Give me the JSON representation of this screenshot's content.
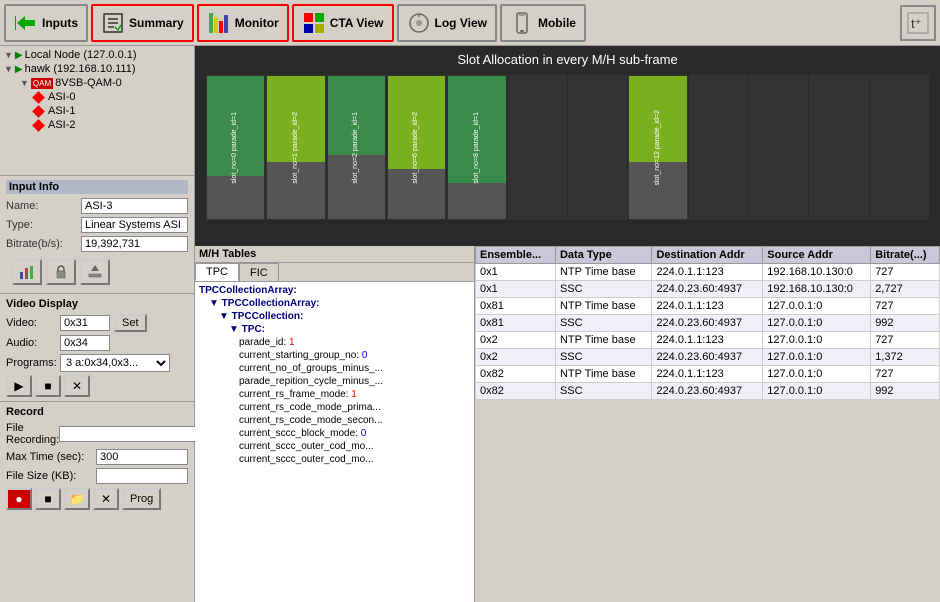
{
  "toolbar": {
    "inputs_label": "Inputs",
    "summary_label": "Summary",
    "monitor_label": "Monitor",
    "cta_view_label": "CTA View",
    "log_view_label": "Log View",
    "mobile_label": "Mobile"
  },
  "tree": {
    "items": [
      {
        "label": "Local Node (127.0.0.1)",
        "level": 0,
        "type": "node"
      },
      {
        "label": "hawk (192.168.10.111)",
        "level": 0,
        "type": "node"
      },
      {
        "label": "8VSB-QAM-0",
        "level": 1,
        "type": "device"
      },
      {
        "label": "ASI-0",
        "level": 2,
        "type": "asi"
      },
      {
        "label": "ASI-1",
        "level": 2,
        "type": "asi"
      },
      {
        "label": "ASI-2",
        "level": 2,
        "type": "asi"
      }
    ]
  },
  "input_info": {
    "title": "Input Info",
    "name_label": "Name:",
    "name_value": "ASI-3",
    "type_label": "Type:",
    "type_value": "Linear Systems ASI",
    "bitrate_label": "Bitrate(b/s):",
    "bitrate_value": "19,392,731"
  },
  "video_display": {
    "title": "Video Display",
    "video_label": "Video:",
    "video_value": "0x31",
    "audio_label": "Audio:",
    "audio_value": "0x34",
    "set_label": "Set",
    "programs_label": "Programs:",
    "programs_value": "3 a:0x34,0x3..."
  },
  "record": {
    "title": "Record",
    "file_recording_label": "File Recording:",
    "max_time_label": "Max Time (sec):",
    "max_time_value": "300",
    "file_size_label": "File Size (KB):",
    "prog_label": "Prog"
  },
  "slot_allocation": {
    "title": "Slot Allocation in every M/H sub-frame",
    "columns": [
      {
        "label": "slot_no=0\nparade_id=1",
        "segments": [
          {
            "pct": 70,
            "color": "green"
          },
          {
            "pct": 30,
            "color": "gray"
          }
        ]
      },
      {
        "label": "slot_no=1\nparade_id=2",
        "segments": [
          {
            "pct": 60,
            "color": "lime"
          },
          {
            "pct": 40,
            "color": "gray"
          }
        ]
      },
      {
        "label": "slot_no=2\nparade_id=1",
        "segments": [
          {
            "pct": 55,
            "color": "green"
          },
          {
            "pct": 45,
            "color": "gray"
          }
        ]
      },
      {
        "label": "slot_no=6\nparade_id=2",
        "segments": [
          {
            "pct": 65,
            "color": "lime"
          },
          {
            "pct": 35,
            "color": "gray"
          }
        ]
      },
      {
        "label": "slot_no=8\nparade_id=1",
        "segments": [
          {
            "pct": 75,
            "color": "green"
          },
          {
            "pct": 25,
            "color": "gray"
          }
        ]
      },
      {
        "label": "",
        "segments": [
          {
            "pct": 100,
            "color": "dark"
          }
        ]
      },
      {
        "label": "",
        "segments": [
          {
            "pct": 100,
            "color": "dark"
          }
        ]
      },
      {
        "label": "slot_no=12\nparade_id=2",
        "segments": [
          {
            "pct": 60,
            "color": "lime"
          },
          {
            "pct": 40,
            "color": "gray"
          }
        ]
      },
      {
        "label": "",
        "segments": [
          {
            "pct": 100,
            "color": "dark"
          }
        ]
      },
      {
        "label": "",
        "segments": [
          {
            "pct": 100,
            "color": "dark"
          }
        ]
      },
      {
        "label": "",
        "segments": [
          {
            "pct": 100,
            "color": "dark"
          }
        ]
      },
      {
        "label": "",
        "segments": [
          {
            "pct": 100,
            "color": "dark"
          }
        ]
      }
    ]
  },
  "mh_tables": {
    "title": "M/H Tables",
    "tabs": [
      "TPC",
      "FIC"
    ],
    "active_tab": "TPC",
    "tree_items": [
      {
        "label": "TPCCollectionArray:",
        "level": 0,
        "bold": true
      },
      {
        "label": "TPCCollectionArray:",
        "level": 1,
        "bold": true
      },
      {
        "label": "TPCCollection:",
        "level": 2,
        "bold": true
      },
      {
        "label": "TPC:",
        "level": 3,
        "bold": true
      },
      {
        "label": "parade_id: 1",
        "level": 4,
        "valueColor": "red"
      },
      {
        "label": "current_starting_group_no: 0",
        "level": 4,
        "valueColor": "blue"
      },
      {
        "label": "current_no_of_groups_minus_...",
        "level": 4
      },
      {
        "label": "parade_repition_cycle_minus_...",
        "level": 4
      },
      {
        "label": "current_rs_frame_mode: 1",
        "level": 4,
        "valueColor": "red"
      },
      {
        "label": "current_rs_code_mode_prima...",
        "level": 4
      },
      {
        "label": "current_rs_code_mode_secon...",
        "level": 4
      },
      {
        "label": "current_sccc_block_mode: 0",
        "level": 4,
        "valueColor": "blue"
      },
      {
        "label": "current_sccc_outer_cod_mo...",
        "level": 4
      },
      {
        "label": "current_sccc_outer_cod_mo...",
        "level": 4
      }
    ]
  },
  "data_table": {
    "headers": [
      "Ensemble...",
      "Data Type",
      "Destination Addr",
      "Source Addr",
      "Bitrate(...)"
    ],
    "rows": [
      {
        "ensemble": "0x1",
        "data_type": "NTP Time base",
        "dest": "224.0.1.1:123",
        "source": "192.168.10.130:0",
        "bitrate": "727"
      },
      {
        "ensemble": "0x1",
        "data_type": "SSC",
        "dest": "224.0.23.60:4937",
        "source": "192.168.10.130:0",
        "bitrate": "2,727"
      },
      {
        "ensemble": "0x81",
        "data_type": "NTP Time base",
        "dest": "224.0.1.1:123",
        "source": "127.0.0.1:0",
        "bitrate": "727"
      },
      {
        "ensemble": "0x81",
        "data_type": "SSC",
        "dest": "224.0.23.60:4937",
        "source": "127.0.0.1:0",
        "bitrate": "992"
      },
      {
        "ensemble": "0x2",
        "data_type": "NTP Time base",
        "dest": "224.0.1.1:123",
        "source": "127.0.0.1:0",
        "bitrate": "727"
      },
      {
        "ensemble": "0x2",
        "data_type": "SSC",
        "dest": "224.0.23.60:4937",
        "source": "127.0.0.1:0",
        "bitrate": "1,372"
      },
      {
        "ensemble": "0x82",
        "data_type": "NTP Time base",
        "dest": "224.0.1.1:123",
        "source": "127.0.0.1:0",
        "bitrate": "727"
      },
      {
        "ensemble": "0x82",
        "data_type": "SSC",
        "dest": "224.0.23.60:4937",
        "source": "127.0.0.1:0",
        "bitrate": "992"
      }
    ]
  }
}
